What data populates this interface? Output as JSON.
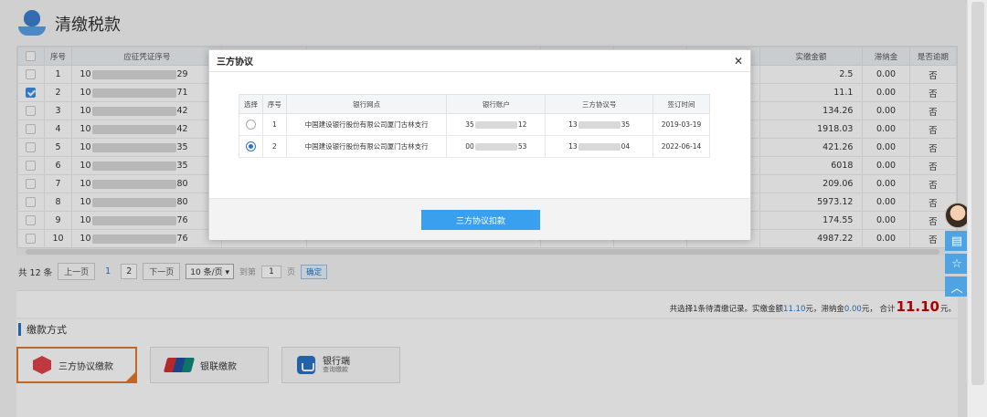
{
  "header": {
    "title": "清缴税款",
    "logo_icon": "tax-hand-icon"
  },
  "table": {
    "columns": [
      "序号",
      "应征凭证序号",
      "实缴金额",
      "滞纳金",
      "是否逾期"
    ],
    "rows": [
      {
        "no": "1",
        "code_pre": "10",
        "code_suf": "29",
        "checked": false,
        "amount": "2.5",
        "late": "0.00",
        "overdue": "否"
      },
      {
        "no": "2",
        "code_pre": "10",
        "code_suf": "71",
        "checked": true,
        "amount": "11.1",
        "late": "0.00",
        "overdue": "否"
      },
      {
        "no": "3",
        "code_pre": "10",
        "code_suf": "42",
        "checked": false,
        "amount": "134.26",
        "late": "0.00",
        "overdue": "否"
      },
      {
        "no": "4",
        "code_pre": "10",
        "code_suf": "42",
        "checked": false,
        "amount": "1918.03",
        "late": "0.00",
        "overdue": "否"
      },
      {
        "no": "5",
        "code_pre": "10",
        "code_suf": "35",
        "checked": false,
        "amount": "421.26",
        "late": "0.00",
        "overdue": "否"
      },
      {
        "no": "6",
        "code_pre": "10",
        "code_suf": "35",
        "checked": false,
        "amount": "6018",
        "late": "0.00",
        "overdue": "否"
      },
      {
        "no": "7",
        "code_pre": "10",
        "code_suf": "80",
        "checked": false,
        "amount": "209.06",
        "late": "0.00",
        "overdue": "否"
      },
      {
        "no": "8",
        "code_pre": "10",
        "code_suf": "80",
        "checked": false,
        "amount": "5973.12",
        "late": "0.00",
        "overdue": "否"
      },
      {
        "no": "9",
        "code_pre": "10",
        "code_suf": "76",
        "checked": false,
        "amount": "174.55",
        "late": "0.00",
        "overdue": "否"
      },
      {
        "no": "10",
        "code_pre": "10",
        "code_suf": "76",
        "checked": false,
        "amount": "4987.22",
        "late": "0.00",
        "overdue": "否"
      }
    ]
  },
  "pager": {
    "total": "共 12 条",
    "prev": "上一页",
    "page1": "1",
    "page2": "2",
    "next": "下一页",
    "page_size": "10 条/页",
    "goto": "到第",
    "goto_value": "1",
    "page_unit": "页",
    "confirm": "确定"
  },
  "summary": {
    "prefix": "共选择1条待清缴记录。实缴金额",
    "amount": "11.10",
    "mid": "元，滞纳金",
    "late": "0.00",
    "mid2": "元， 合计",
    "total": "11.10",
    "suffix": "元。"
  },
  "payment": {
    "section_title": "缴款方式",
    "options": [
      {
        "label": "三方协议缴款",
        "icon": "tripartite-icon"
      },
      {
        "label": "银联缴款",
        "icon": "unionpay-icon"
      },
      {
        "label": "银行端",
        "sub": "查询缴款",
        "icon": "bank-icon"
      }
    ]
  },
  "modal": {
    "title": "三方协议",
    "columns": [
      "选择",
      "序号",
      "银行网点",
      "银行账户",
      "三方协议号",
      "签订时间"
    ],
    "rows": [
      {
        "selected": false,
        "no": "1",
        "bank": "中国建设银行股份有限公司厦门古林支行",
        "acct_pre": "35",
        "acct_suf": "12",
        "proto_pre": "13",
        "proto_suf": "35",
        "date": "2019-03-19"
      },
      {
        "selected": true,
        "no": "2",
        "bank": "中国建设银行股份有限公司厦门古林支行",
        "acct_pre": "00",
        "acct_suf": "53",
        "proto_pre": "13",
        "proto_suf": "04",
        "date": "2022-06-14"
      }
    ],
    "action": "三方协议扣款"
  },
  "colors": {
    "accent": "#39a0f0",
    "active_border": "#e07a2e",
    "total_red": "#cc0000"
  }
}
